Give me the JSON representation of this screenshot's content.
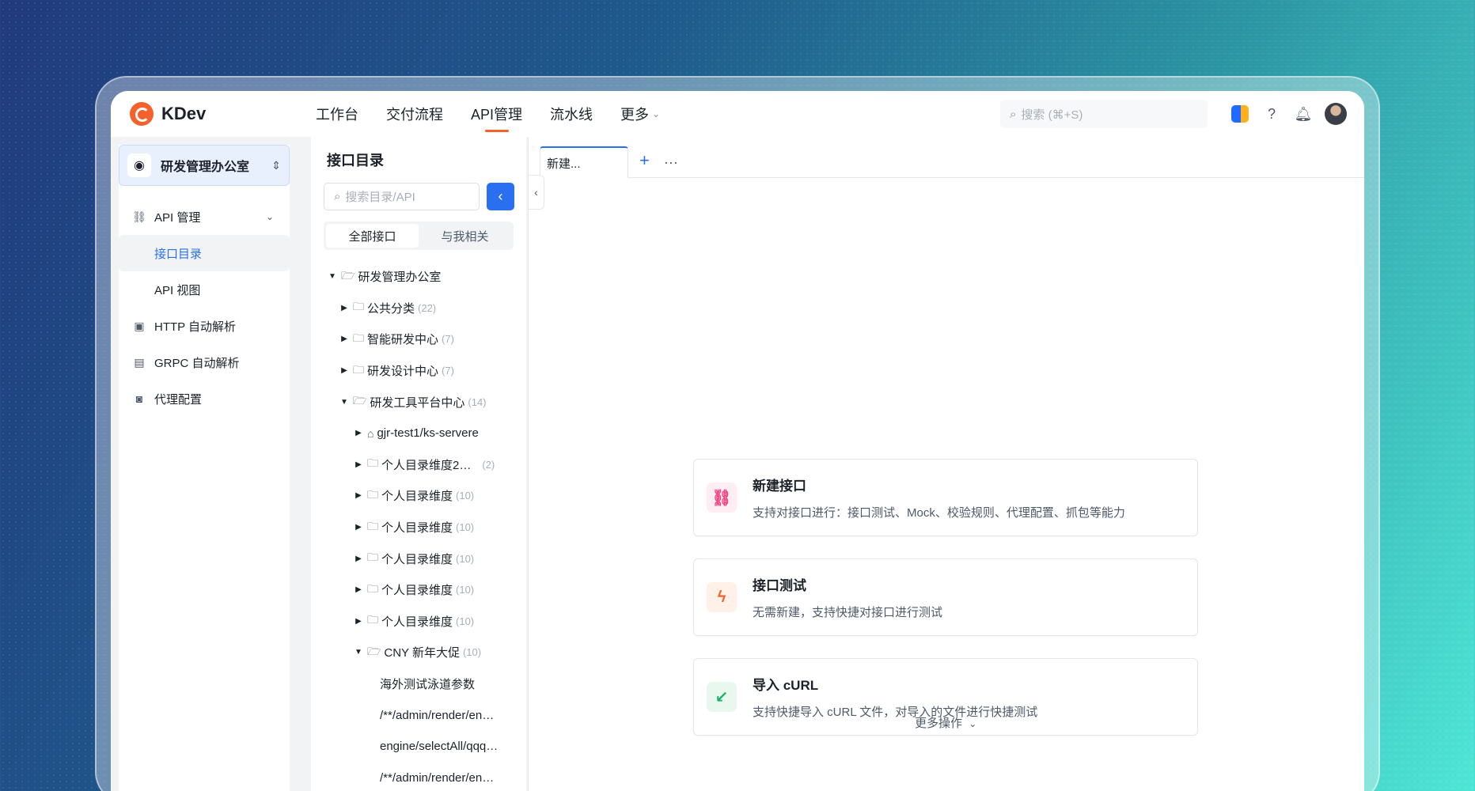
{
  "app": {
    "name": "KDev"
  },
  "nav": {
    "items": [
      "工作台",
      "交付流程",
      "API管理",
      "流水线",
      "更多"
    ],
    "active": "API管理"
  },
  "header": {
    "search_placeholder": "搜索 (⌘+S)"
  },
  "workspace": {
    "name": "研发管理办公室"
  },
  "sidebar": {
    "items": [
      {
        "label": "API 管理",
        "icon": "link-icon"
      },
      {
        "label": "接口目录"
      },
      {
        "label": "API 视图"
      },
      {
        "label": "HTTP 自动解析",
        "icon": "monitor-icon"
      },
      {
        "label": "GRPC 自动解析",
        "icon": "chart-icon"
      },
      {
        "label": "代理配置",
        "icon": "proxy-icon"
      }
    ]
  },
  "tree": {
    "title": "接口目录",
    "search_placeholder": "搜索目录/API",
    "segments": [
      "全部接口",
      "与我相关"
    ],
    "nodes": [
      {
        "label": "研发管理办公室",
        "count": ""
      },
      {
        "label": "公共分类",
        "count": "(22)"
      },
      {
        "label": "智能研发中心",
        "count": "(7)"
      },
      {
        "label": "研发设计中心",
        "count": "(7)"
      },
      {
        "label": "研发工具平台中心",
        "count": "(14)"
      },
      {
        "label": "gjr-test1/ks-servere",
        "count": ""
      },
      {
        "label": "个人目录维度2…",
        "count": "(2)"
      },
      {
        "label": "个人目录维度",
        "count": "(10)"
      },
      {
        "label": "个人目录维度",
        "count": "(10)"
      },
      {
        "label": "个人目录维度",
        "count": "(10)"
      },
      {
        "label": "个人目录维度",
        "count": "(10)"
      },
      {
        "label": "个人目录维度",
        "count": "(10)"
      },
      {
        "label": "CNY 新年大促",
        "count": "(10)"
      },
      {
        "label": "海外测试泳道参数",
        "count": ""
      },
      {
        "label": "/**/admin/render/en…",
        "count": ""
      },
      {
        "label": "engine/selectAll/qqq…",
        "count": ""
      },
      {
        "label": "/**/admin/render/en…",
        "count": ""
      }
    ]
  },
  "tabs": [
    {
      "label": "新建..."
    }
  ],
  "cards": [
    {
      "title": "新建接口",
      "desc": "支持对接口进行：接口测试、Mock、校验规则、代理配置、抓包等能力",
      "icon": "link-icon",
      "color": "#f53f7a",
      "bg": "#feedf3"
    },
    {
      "title": "接口测试",
      "desc": "无需新建，支持快捷对接口进行测试",
      "icon": "lightning-icon",
      "color": "#f4612a",
      "bg": "#fff1e8"
    },
    {
      "title": "导入 cURL",
      "desc": "支持快捷导入 cURL 文件，对导入的文件进行快捷测试",
      "icon": "import-icon",
      "color": "#17b26a",
      "bg": "#e8f8ef"
    }
  ],
  "more_ops": "更多操作"
}
